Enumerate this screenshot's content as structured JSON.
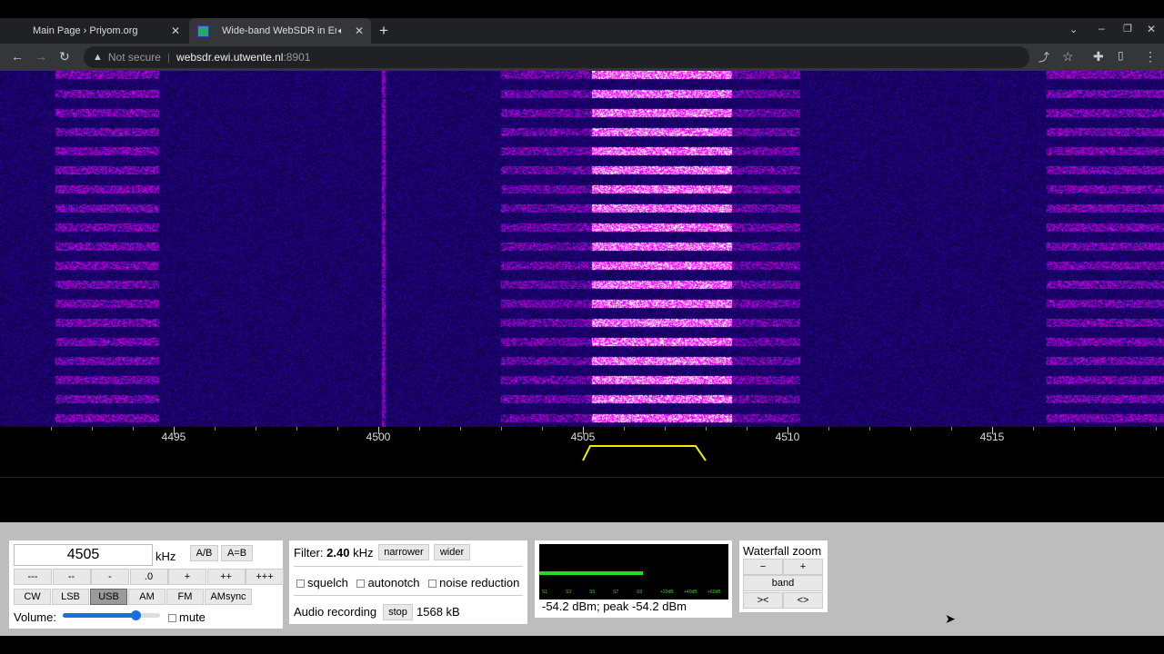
{
  "browser": {
    "tabs": [
      {
        "title": "Main Page › Priyom.org",
        "active": false
      },
      {
        "title": "Wide-band WebSDR in Ensch",
        "active": true,
        "audio": true
      }
    ],
    "security": "Not secure",
    "url_host": "websdr.ewi.utwente.nl",
    "url_port": ":8901"
  },
  "scale": {
    "labels": [
      "4495",
      "4500",
      "4505",
      "4510",
      "4515"
    ]
  },
  "tuning": {
    "frequency": "4505",
    "unit": "kHz",
    "ab": "A/B",
    "aeqb": "A=B",
    "steps": [
      "---",
      "--",
      "-",
      ".0",
      "+",
      "++",
      "+++"
    ],
    "modes": [
      "CW",
      "LSB",
      "USB",
      "AM",
      "FM",
      "AMsync"
    ],
    "selected_mode": "USB",
    "volume_label": "Volume:",
    "volume_level": 0.75,
    "mute_label": "mute",
    "mute": false
  },
  "filter": {
    "label": "Filter:",
    "width": "2.40",
    "unit": "kHz",
    "narrower": "narrower",
    "wider": "wider",
    "checkboxes": [
      {
        "label": "squelch",
        "checked": false
      },
      {
        "label": "autonotch",
        "checked": false
      },
      {
        "label": "noise reduction",
        "checked": false
      }
    ],
    "recording_label": "Audio recording",
    "stop": "stop",
    "size": "1568 kB"
  },
  "smeter": {
    "level": 0.55,
    "scale": [
      "S1",
      "S3",
      "S5",
      "S7",
      "S9",
      "+20dB",
      "+40dB",
      "+60dB"
    ],
    "readout": "-54.2 dBm; peak  -54.2 dBm",
    "color": "#22dd22"
  },
  "zoom": {
    "title": "Waterfall zoom",
    "minus": "−",
    "plus": "+",
    "band": "band",
    "narrow": "><",
    "wide": "<>"
  }
}
